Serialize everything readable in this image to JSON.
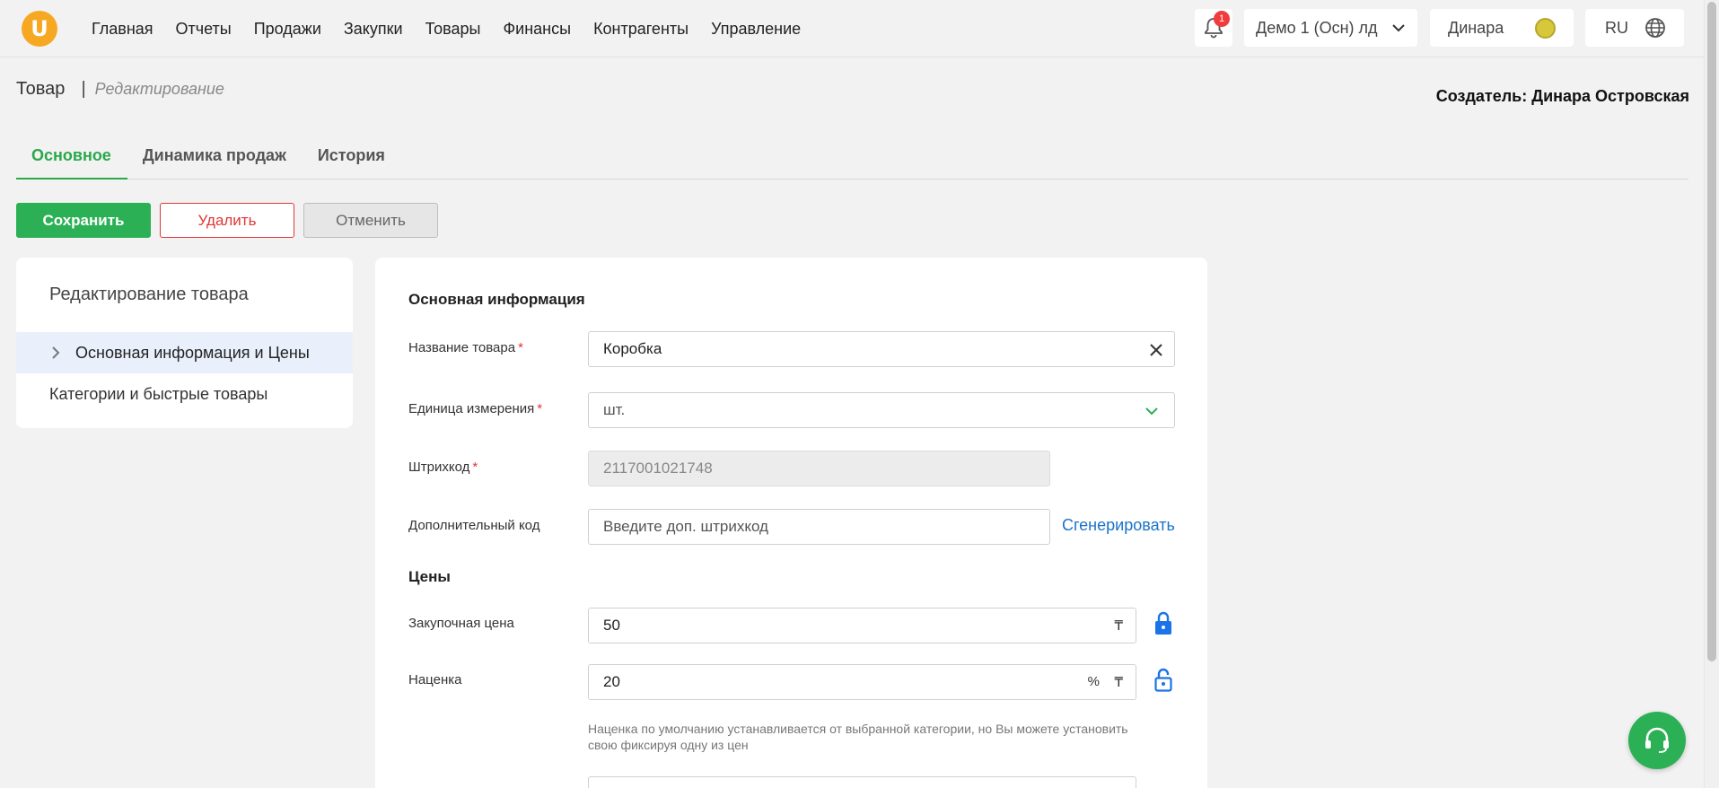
{
  "nav": {
    "logo": "U",
    "items": [
      "Главная",
      "Отчеты",
      "Продажи",
      "Закупки",
      "Товары",
      "Финансы",
      "Контрагенты",
      "Управление"
    ],
    "notifications_count": "1",
    "company": "Демо 1 (Осн) лд",
    "user": "Динара",
    "language": "RU"
  },
  "header": {
    "title": "Товар",
    "separator": "|",
    "subtitle": "Редактирование",
    "creator": "Создатель: Динара Островская"
  },
  "tabs": [
    "Основное",
    "Динамика продаж",
    "История"
  ],
  "actions": {
    "save": "Сохранить",
    "delete": "Удалить",
    "cancel": "Отменить"
  },
  "sidebar": {
    "title": "Редактирование товара",
    "items": [
      "Основная информация и Цены",
      "Категории и быстрые товары"
    ]
  },
  "form": {
    "section_main": "Основная информация",
    "name_label": "Название товара",
    "name_value": "Коробка",
    "unit_label": "Единица измерения",
    "unit_value": "шт.",
    "barcode_label": "Штрихкод",
    "barcode_value": "2117001021748",
    "extra_code_label": "Дополнительный код",
    "extra_code_placeholder": "Введите доп. штрихкод",
    "generate_link": "Сгенерировать",
    "section_prices": "Цены",
    "purchase_label": "Закупочная цена",
    "purchase_value": "50",
    "currency": "₸",
    "markup_label": "Наценка",
    "markup_value": "20",
    "percent": "%",
    "markup_hint": "Наценка по умолчанию устанавливается от выбранной категории, но Вы можете установить свою фиксируя одну из цен",
    "required_mark": "*"
  },
  "colors": {
    "accent_green": "#2cb055",
    "danger_red": "#e13535",
    "link_blue": "#1a73c9",
    "logo_orange": "#f7a823"
  }
}
